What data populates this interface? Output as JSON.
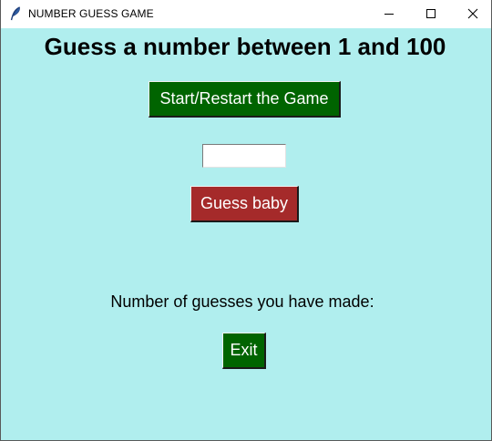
{
  "window": {
    "title": "NUMBER GUESS GAME",
    "app_icon": "feather-icon",
    "controls": {
      "minimize_icon": "minimize-icon",
      "maximize_icon": "maximize-icon",
      "close_icon": "close-icon"
    },
    "background_color": "#b0eeee"
  },
  "game": {
    "heading": "Guess a number between 1 and 100",
    "start_button_label": "Start/Restart the Game",
    "start_button_color": "#006400",
    "guess_input_value": "",
    "guess_button_label": "Guess baby",
    "guess_button_color": "#a52a2a",
    "guess_count_text": "Number of guesses you have made:",
    "exit_button_label": "Exit",
    "exit_button_color": "#006400"
  }
}
